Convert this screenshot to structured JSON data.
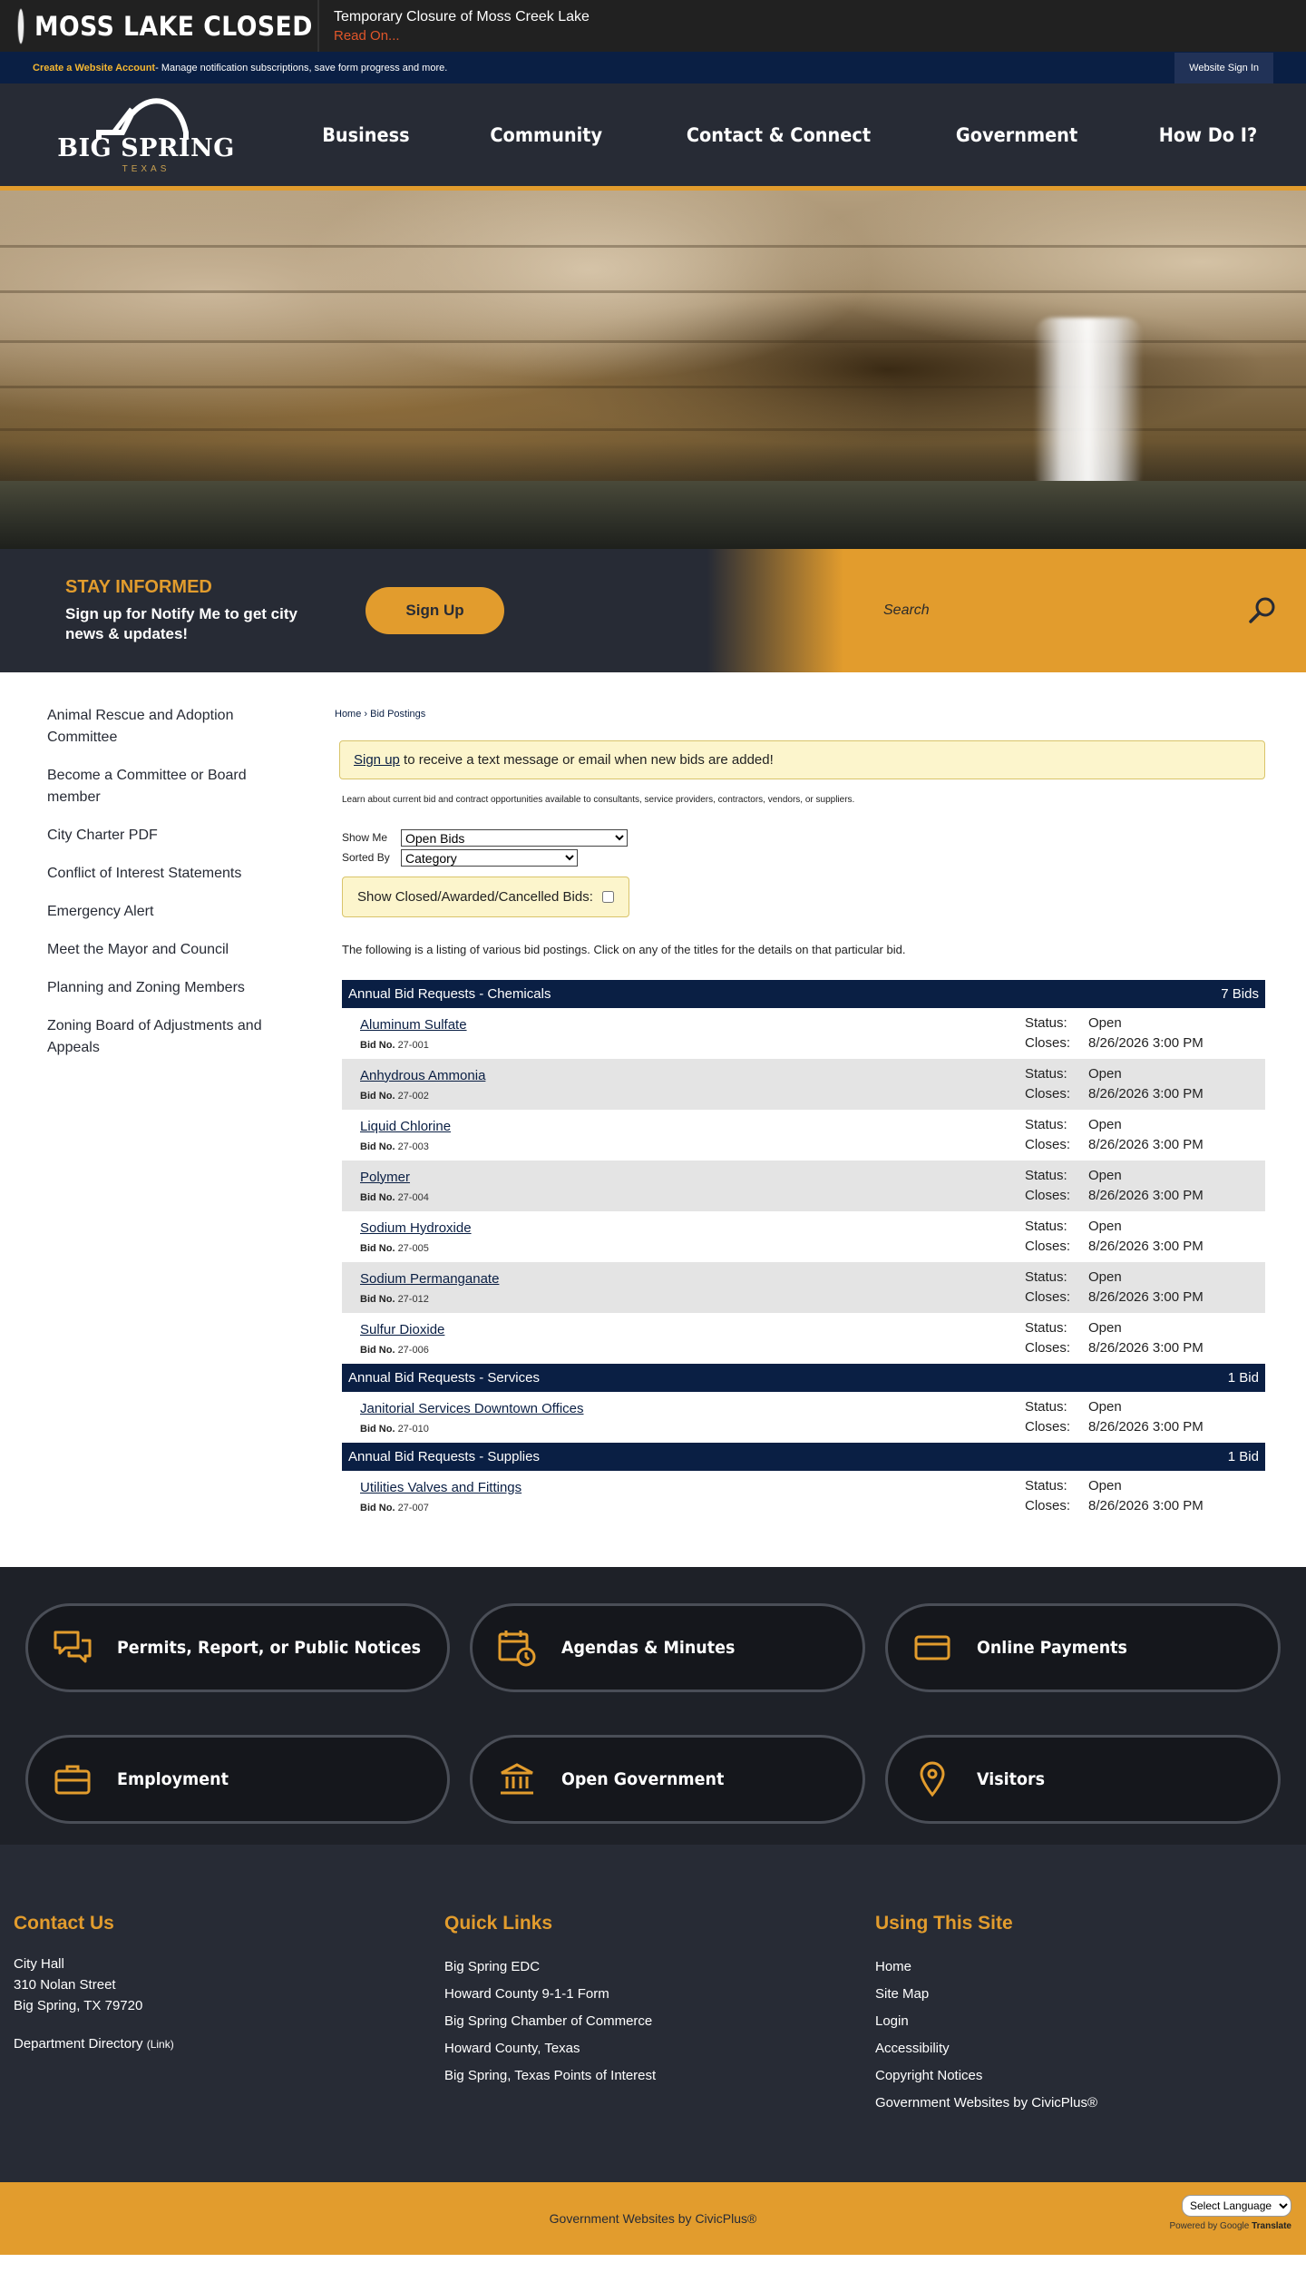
{
  "alert": {
    "title": "MOSS LAKE CLOSED",
    "message": "Temporary Closure of Moss Creek Lake",
    "link": "Read On..."
  },
  "account_bar": {
    "create_label": "Create a Website Account",
    "create_desc": " - Manage notification subscriptions, save form progress and more.",
    "signin_label": "Website Sign In"
  },
  "logo": {
    "name": "BIG SPRING",
    "sub": "TEXAS"
  },
  "nav": [
    "Business",
    "Community",
    "Contact & Connect",
    "Government",
    "How Do I?"
  ],
  "stay": {
    "title": "STAY INFORMED",
    "desc_a": "Sign up for ",
    "desc_b": "Notify Me",
    "desc_c": " to get city news & updates!",
    "button": "Sign Up"
  },
  "search": {
    "placeholder": "Search"
  },
  "sidebar": [
    "Animal Rescue and Adoption Committee",
    "Become a Committee or Board member",
    "City Charter PDF",
    "Conflict of Interest Statements",
    "Emergency Alert",
    "Meet the Mayor and Council",
    "Planning and Zoning Members",
    "Zoning Board of Adjustments and Appeals"
  ],
  "breadcrumb": {
    "home": "Home",
    "sep": " › ",
    "current": "Bid Postings"
  },
  "notice": {
    "link": "Sign up",
    "text": " to receive a text message or email when new bids are added!"
  },
  "learn": "Learn about current bid and contract opportunities available to consultants, service providers, contractors, vendors, or suppliers.",
  "controls": {
    "show_me_label": "Show Me",
    "show_me_value": "Open Bids",
    "sorted_by_label": "Sorted By",
    "sorted_by_value": "Category",
    "closed_label": "Show Closed/Awarded/Cancelled Bids:"
  },
  "listing_intro": "The following is a listing of various bid postings. Click on any of the titles for the details on that particular bid.",
  "labels": {
    "bid_no": "Bid No.",
    "status": "Status:",
    "closes": "Closes:"
  },
  "categories": [
    {
      "name": "Annual Bid Requests - Chemicals",
      "count": "7 Bids",
      "bids": [
        {
          "title": "Aluminum Sulfate",
          "number": "27-001",
          "status": "Open",
          "closes": "8/26/2026 3:00 PM"
        },
        {
          "title": "Anhydrous Ammonia",
          "number": "27-002",
          "status": "Open",
          "closes": "8/26/2026 3:00 PM"
        },
        {
          "title": "Liquid Chlorine",
          "number": "27-003",
          "status": "Open",
          "closes": "8/26/2026 3:00 PM"
        },
        {
          "title": "Polymer",
          "number": "27-004",
          "status": "Open",
          "closes": "8/26/2026 3:00 PM"
        },
        {
          "title": "Sodium Hydroxide",
          "number": "27-005",
          "status": "Open",
          "closes": "8/26/2026 3:00 PM"
        },
        {
          "title": "Sodium Permanganate",
          "number": "27-012",
          "status": "Open",
          "closes": "8/26/2026 3:00 PM"
        },
        {
          "title": "Sulfur Dioxide",
          "number": "27-006",
          "status": "Open",
          "closes": "8/26/2026 3:00 PM"
        }
      ]
    },
    {
      "name": "Annual Bid Requests - Services",
      "count": "1 Bid",
      "bids": [
        {
          "title": "Janitorial Services Downtown Offices",
          "number": "27-010",
          "status": "Open",
          "closes": "8/26/2026 3:00 PM"
        }
      ]
    },
    {
      "name": "Annual Bid Requests - Supplies",
      "count": "1 Bid",
      "bids": [
        {
          "title": "Utilities Valves and Fittings",
          "number": "27-007",
          "status": "Open",
          "closes": "8/26/2026 3:00 PM"
        }
      ]
    }
  ],
  "tiles": [
    {
      "label": "Permits, Report, or Public Notices",
      "icon": "chat-bubbles-icon"
    },
    {
      "label": "Agendas & Minutes",
      "icon": "calendar-clock-icon"
    },
    {
      "label": "Online Payments",
      "icon": "credit-card-icon"
    },
    {
      "label": "Employment",
      "icon": "briefcase-icon"
    },
    {
      "label": "Open Government",
      "icon": "government-building-icon"
    },
    {
      "label": "Visitors",
      "icon": "map-pin-icon"
    }
  ],
  "footer": {
    "contact": {
      "title": "Contact Us",
      "lines": [
        "City Hall",
        "310 Nolan Street",
        "Big Spring, TX 79720"
      ],
      "dept": "Department Directory",
      "dept_suffix": "(Link)"
    },
    "quick_links": {
      "title": "Quick Links",
      "items": [
        "Big Spring EDC",
        "Howard County 9-1-1 Form",
        "Big Spring Chamber of Commerce",
        "Howard County, Texas",
        "Big Spring, Texas Points of Interest"
      ]
    },
    "using_site": {
      "title": "Using This Site",
      "items": [
        "Home",
        "Site Map",
        "Login",
        "Accessibility",
        "Copyright Notices",
        "Government Websites by CivicPlus®"
      ]
    }
  },
  "bottom": {
    "text": "Government Websites by CivicPlus®",
    "lang": "Select Language",
    "powered_a": "Powered by ",
    "powered_b": "Google",
    "powered_c": " Translate"
  },
  "colors": {
    "navy": "#0a1f44",
    "gold": "#e29c2d",
    "charcoal": "#272b35"
  }
}
